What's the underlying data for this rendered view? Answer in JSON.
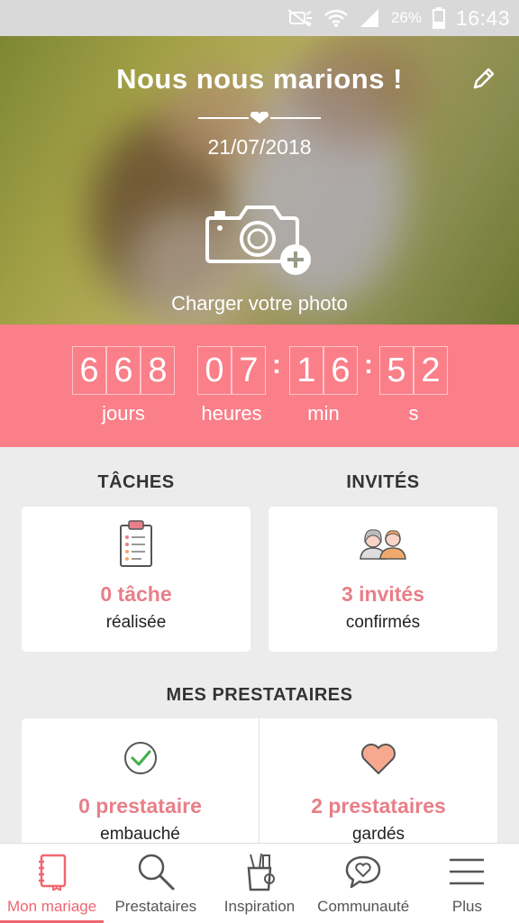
{
  "status_bar": {
    "battery": "26%",
    "time": "16:43"
  },
  "hero": {
    "title": "Nous nous marions !",
    "date": "21/07/2018",
    "upload_label": "Charger votre photo"
  },
  "countdown": {
    "days": [
      "6",
      "6",
      "8"
    ],
    "hours": [
      "0",
      "7"
    ],
    "minutes": [
      "1",
      "6"
    ],
    "seconds": [
      "5",
      "2"
    ],
    "labels": {
      "days": "jours",
      "hours": "heures",
      "minutes": "min",
      "seconds": "s"
    }
  },
  "tasks": {
    "heading": "TÂCHES",
    "count": "0 tâche",
    "sub": "réalisée"
  },
  "guests": {
    "heading": "INVITÉS",
    "count": "3 invités",
    "sub": "confirmés"
  },
  "vendors": {
    "heading": "MES PRESTATAIRES",
    "hired": {
      "count": "0 prestataire",
      "sub": "embauché"
    },
    "saved": {
      "count": "2 prestataires",
      "sub": "gardés"
    }
  },
  "nav": [
    {
      "label": "Mon mariage",
      "icon": "notebook-icon",
      "active": true
    },
    {
      "label": "Prestataires",
      "icon": "search-icon"
    },
    {
      "label": "Inspiration",
      "icon": "pencil-cup-icon"
    },
    {
      "label": "Communauté",
      "icon": "heart-chat-icon"
    },
    {
      "label": "Plus",
      "icon": "menu-icon"
    }
  ],
  "colors": {
    "accent": "#fa7f89",
    "accent_text": "#e87f88",
    "nav_active": "#f06671"
  }
}
